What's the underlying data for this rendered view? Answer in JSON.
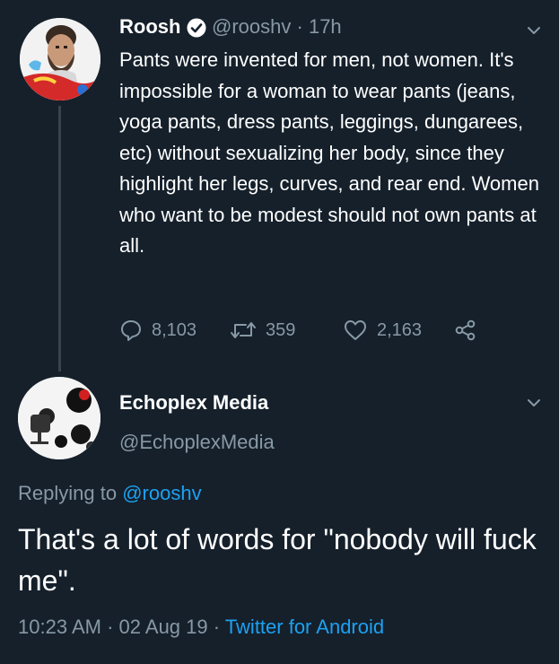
{
  "colors": {
    "background": "#15202b",
    "text_primary": "#ffffff",
    "text_secondary": "#8899a6",
    "link": "#1da1f2",
    "thread_line": "#38444d"
  },
  "original_tweet": {
    "author_name": "Roosh",
    "verified": true,
    "handle": "@rooshv",
    "separator": "·",
    "time_ago": "17h",
    "text": "Pants were invented for men, not women. It's impossible for a woman to wear pants (jeans, yoga pants, dress pants, leggings, dungarees, etc) without sexualizing her body, since they highlight her legs, curves, and rear end. Women who want to be modest should not own pants at all.",
    "actions": {
      "replies": "8,103",
      "retweets": "359",
      "likes": "2,163"
    }
  },
  "reply_tweet": {
    "author_name": "Echoplex Media",
    "handle": "@EchoplexMedia",
    "replying_prefix": "Replying to",
    "replying_to": "@rooshv",
    "text": "That's a lot of words for \"nobody will fuck me\".",
    "time": "10:23 AM",
    "date": "02 Aug 19",
    "separator": "·",
    "source": "Twitter for Android"
  },
  "icons": {
    "verified": "verified-badge-icon",
    "more": "chevron-down-icon",
    "reply": "reply-bubble-icon",
    "retweet": "retweet-icon",
    "like": "heart-icon",
    "share": "share-icon"
  }
}
